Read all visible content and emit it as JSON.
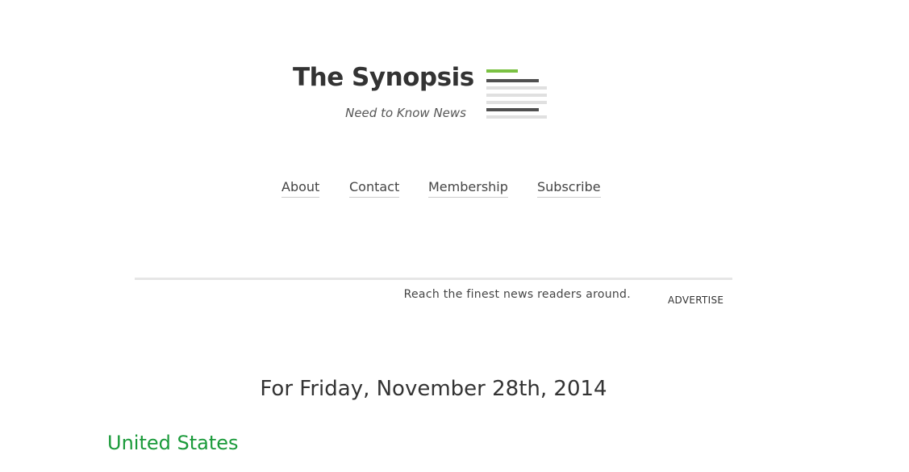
{
  "brand": {
    "title": "The Synopsis",
    "tagline": "Need to Know News",
    "icon": "newspaper-lines-icon",
    "accent_color": "#7ac142",
    "dark_line_color": "#505050",
    "light_line_color": "#e0e0e0"
  },
  "nav": {
    "items": [
      {
        "label": "About"
      },
      {
        "label": "Contact"
      },
      {
        "label": "Membership"
      },
      {
        "label": "Subscribe"
      }
    ]
  },
  "ad_banner": {
    "text": "Reach the finest news readers around.",
    "link_label": "ADVERTISE"
  },
  "main": {
    "date_heading": "For Friday, November 28th, 2014",
    "section_heading": "United States",
    "section_color": "#1a9a3a"
  }
}
